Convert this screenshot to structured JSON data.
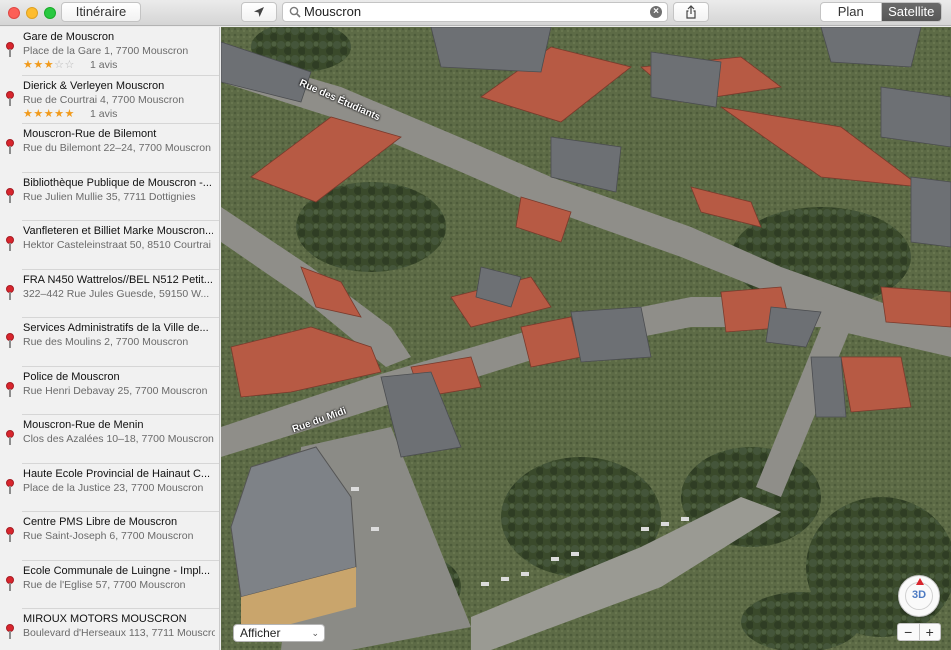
{
  "toolbar": {
    "itinerary_label": "Itinéraire",
    "search_value": "Mouscron",
    "view_plan": "Plan",
    "view_satellite": "Satellite",
    "locate_icon": "location-arrow-icon",
    "share_icon": "share-icon"
  },
  "results": [
    {
      "name": "Gare de Mouscron",
      "address": "Place de la Gare 1, 7700 Mouscron",
      "stars": 3,
      "reviews": "1 avis"
    },
    {
      "name": "Dierick & Verleyen Mouscron",
      "address": "Rue de Courtrai 4, 7700 Mouscron",
      "stars": 5,
      "reviews": "1 avis"
    },
    {
      "name": "Mouscron-Rue de Bilemont",
      "address": "Rue du Bilemont 22–24, 7700 Mouscron"
    },
    {
      "name": "Bibliothèque Publique de Mouscron -...",
      "address": "Rue Julien Mullie 35, 7711 Dottignies"
    },
    {
      "name": "Vanfleteren et Billiet Marke Mouscron...",
      "address": "Hektor Casteleinstraat 50, 8510 Courtrai"
    },
    {
      "name": "FRA N450 Wattrelos//BEL N512 Petit...",
      "address": "322–442 Rue Jules Guesde, 59150 W..."
    },
    {
      "name": "Services Administratifs de la Ville de...",
      "address": "Rue des Moulins 2, 7700 Mouscron"
    },
    {
      "name": "Police de Mouscron",
      "address": "Rue Henri Debavay 25, 7700 Mouscron"
    },
    {
      "name": "Mouscron-Rue de Menin",
      "address": "Clos des Azalées 10–18, 7700 Mouscron"
    },
    {
      "name": "Haute Ecole Provincial de Hainaut C...",
      "address": "Place de la Justice 23, 7700 Mouscron"
    },
    {
      "name": "Centre PMS Libre de Mouscron",
      "address": "Rue Saint-Joseph 6, 7700 Mouscron"
    },
    {
      "name": "Ecole Communale de Luingne - Impl...",
      "address": "Rue de l'Eglise 57, 7700 Mouscron"
    },
    {
      "name": "MIROUX MOTORS MOUSCRON",
      "address": "Boulevard d'Herseaux 113, 7711 Mouscron"
    }
  ],
  "map": {
    "street_1": "Rue des Étudiants",
    "street_2": "Rue du Midi",
    "display_dropdown": "Afficher",
    "compass_label": "3D",
    "zoom_out": "−",
    "zoom_in": "+"
  }
}
